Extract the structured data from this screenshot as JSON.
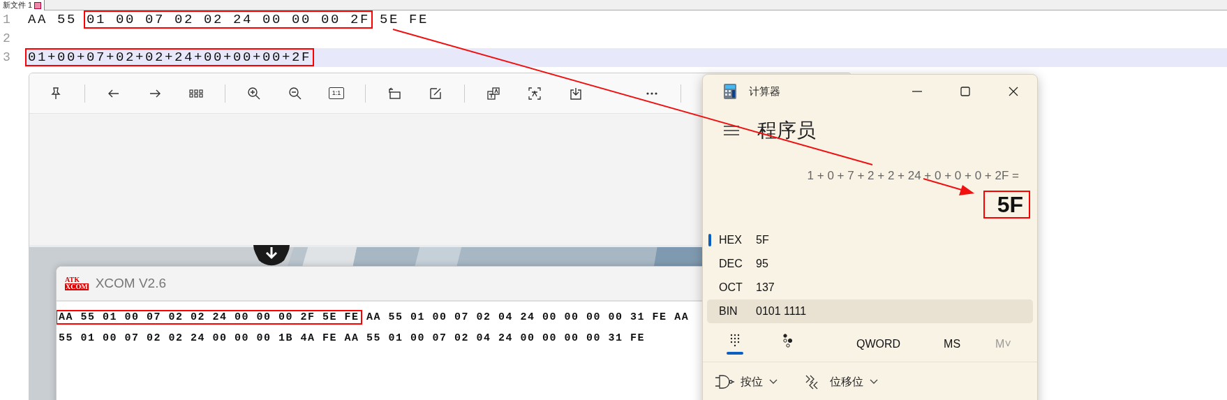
{
  "editor": {
    "tab": {
      "label": "新文件 1",
      "modified": true
    },
    "lines": [
      {
        "number": "1",
        "current": false,
        "segments": [
          {
            "text": "AA 55 ",
            "boxed": false
          },
          {
            "text": "01 00 07 02 02 24 00 00 00 2F",
            "boxed": true
          },
          {
            "text": " 5E FE",
            "boxed": false
          }
        ]
      },
      {
        "number": "2",
        "current": false
      },
      {
        "number": "3",
        "current": true,
        "segments": [
          {
            "text": "01+00+07+02+02+24+00+00+00+2F",
            "boxed": true
          }
        ]
      }
    ]
  },
  "image_viewer": {
    "toolbar": [
      {
        "kind": "pin"
      },
      {
        "kind": "separator"
      },
      {
        "kind": "back"
      },
      {
        "kind": "forward"
      },
      {
        "kind": "grid"
      },
      {
        "kind": "separator"
      },
      {
        "kind": "zoom-in"
      },
      {
        "kind": "zoom-out"
      },
      {
        "kind": "actual-size",
        "label": "1:1"
      },
      {
        "kind": "separator"
      },
      {
        "kind": "rotate"
      },
      {
        "kind": "edit"
      },
      {
        "kind": "separator"
      },
      {
        "kind": "translate"
      },
      {
        "kind": "scan"
      },
      {
        "kind": "save"
      },
      {
        "kind": "spacer"
      },
      {
        "kind": "more"
      },
      {
        "kind": "separator"
      }
    ]
  },
  "xcom": {
    "logo": [
      "ATK",
      "XCOM"
    ],
    "title": "XCOM V2.6",
    "lines": [
      [
        {
          "text": "AA 55 01 00 07 02 02 24 00 00 00 2F 5E FE",
          "boxed": true
        },
        {
          "text": " AA 55 01 00 07 02 04 24 00 00 00 00 31 FE AA",
          "boxed": false
        }
      ],
      [
        {
          "text": "55 01 00 07 02 02 24 00 00 00 1B 4A FE AA 55 01 00 07 02 04 24 00 00 00 00 31 FE",
          "boxed": false
        }
      ]
    ]
  },
  "calculator": {
    "title": "计算器",
    "mode": "程序员",
    "expression": "1 + 0 + 7 + 2 + 2 + 24 + 0 + 0 + 0 + 2F =",
    "result": {
      "text": "5F",
      "boxed": true
    },
    "radix": [
      {
        "label": "HEX",
        "value": "5F",
        "selected": true,
        "highlighted": false
      },
      {
        "label": "DEC",
        "value": "95",
        "selected": false,
        "highlighted": false
      },
      {
        "label": "OCT",
        "value": "137",
        "selected": false,
        "highlighted": false
      },
      {
        "label": "BIN",
        "value": "0101 1111",
        "selected": false,
        "highlighted": true
      }
    ],
    "keypad_tabs": [
      {
        "kind": "keypad",
        "selected": true
      },
      {
        "kind": "bits",
        "selected": false
      }
    ],
    "word_size": "QWORD",
    "memory": [
      {
        "label": "MS",
        "disabled": false
      },
      {
        "label": "M˅",
        "disabled": true
      }
    ],
    "operations": [
      {
        "kind": "bitwise",
        "label": "按位"
      },
      {
        "kind": "shift",
        "label": "位移位"
      }
    ]
  }
}
